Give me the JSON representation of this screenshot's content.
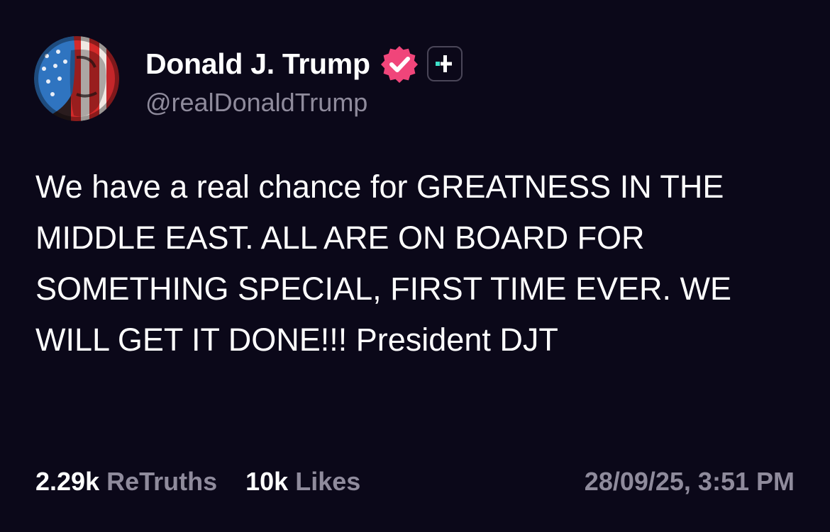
{
  "colors": {
    "background": "#0b0819",
    "text_primary": "#ffffff",
    "text_secondary": "#8f8b9c",
    "verified_badge": "#f0457a",
    "plus_accent": "#3ee0c9",
    "avatar_red": "#d42a2a",
    "avatar_blue": "#2f74c0"
  },
  "author": {
    "display_name": "Donald J. Trump",
    "handle": "@realDonaldTrump",
    "avatar_icon": "profile-avatar",
    "verified_icon": "verified-badge-icon",
    "subscription_icon": "plus-badge-icon"
  },
  "post": {
    "body": "We have a real chance for GREATNESS IN THE MIDDLE EAST. ALL ARE ON BOARD FOR SOMETHING SPECIAL, FIRST TIME EVER. WE WILL GET IT DONE!!! President DJT"
  },
  "stats": {
    "retruths_count": "2.29k",
    "retruths_label": "ReTruths",
    "likes_count": "10k",
    "likes_label": "Likes"
  },
  "timestamp": "28/09/25, 3:51 PM"
}
